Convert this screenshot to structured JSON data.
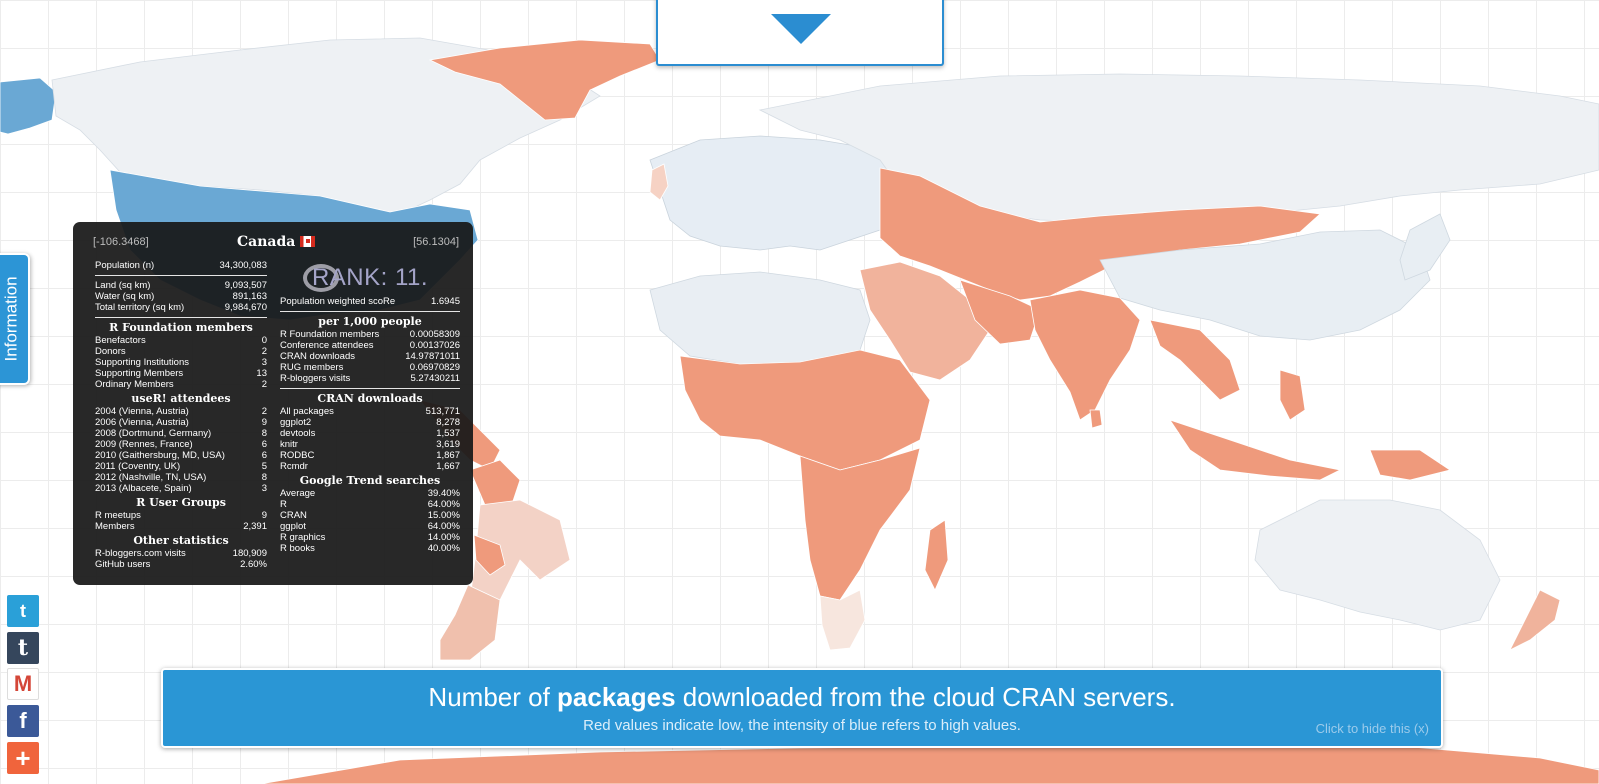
{
  "colors": {
    "accent": "#2a96d5",
    "low": "#ef9a7c",
    "high": "#6aa8d4",
    "neutral": "#eef1f4"
  },
  "info_tab": {
    "label": "Information"
  },
  "tooltip": {
    "coord_left": "[-106.3468]",
    "coord_right": "[56.1304]",
    "country": "Canada",
    "rank": "RANK: 11.",
    "basic": [
      {
        "label": "Population (n)",
        "value": "34,300,083"
      }
    ],
    "area": [
      {
        "label": "Land (sq km)",
        "value": "9,093,507"
      },
      {
        "label": "Water (sq km)",
        "value": "891,163"
      },
      {
        "label": "Total territory (sq km)",
        "value": "9,984,670"
      }
    ],
    "rf_title": "R Foundation members",
    "rf": [
      {
        "label": "Benefactors",
        "value": "0"
      },
      {
        "label": "Donors",
        "value": "2"
      },
      {
        "label": "Supporting Institutions",
        "value": "3"
      },
      {
        "label": "Supporting Members",
        "value": "13"
      },
      {
        "label": "Ordinary Members",
        "value": "2"
      }
    ],
    "user_title": "useR! attendees",
    "user": [
      {
        "label": "2004 (Vienna, Austria)",
        "value": "2"
      },
      {
        "label": "2006 (Vienna, Austria)",
        "value": "9"
      },
      {
        "label": "2008 (Dortmund, Germany)",
        "value": "8"
      },
      {
        "label": "2009 (Rennes, France)",
        "value": "6"
      },
      {
        "label": "2010 (Gaithersburg, MD, USA)",
        "value": "6"
      },
      {
        "label": "2011 (Coventry, UK)",
        "value": "5"
      },
      {
        "label": "2012 (Nashville, TN, USA)",
        "value": "8"
      },
      {
        "label": "2013 (Albacete, Spain)",
        "value": "3"
      }
    ],
    "rug_title": "R User Groups",
    "rug": [
      {
        "label": "R meetups",
        "value": "9"
      },
      {
        "label": "Members",
        "value": "2,391"
      }
    ],
    "other_title": "Other statistics",
    "other": [
      {
        "label": "R-bloggers.com visits",
        "value": "180,909"
      },
      {
        "label": "GitHub users",
        "value": "2.60%"
      }
    ],
    "weighted": {
      "label": "Population weighted scoRe",
      "value": "1.6945"
    },
    "per1000_title": "per 1,000 people",
    "per1000": [
      {
        "label": "R Foundation members",
        "value": "0.00058309"
      },
      {
        "label": "Conference attendees",
        "value": "0.00137026"
      },
      {
        "label": "CRAN downloads",
        "value": "14.97871011"
      },
      {
        "label": "RUG members",
        "value": "0.06970829"
      },
      {
        "label": "R-bloggers visits",
        "value": "5.27430211"
      }
    ],
    "cran_title": "CRAN downloads",
    "cran": [
      {
        "label": "All packages",
        "value": "513,771"
      },
      {
        "label": "ggplot2",
        "value": "8,278"
      },
      {
        "label": "devtools",
        "value": "1,537"
      },
      {
        "label": "knitr",
        "value": "3,619"
      },
      {
        "label": "RODBC",
        "value": "1,867"
      },
      {
        "label": "Rcmdr",
        "value": "1,667"
      }
    ],
    "trends_title": "Google Trend searches",
    "trends": [
      {
        "label": "Average",
        "value": "39.40%"
      },
      {
        "label": "R",
        "value": "64.00%"
      },
      {
        "label": "CRAN",
        "value": "15.00%"
      },
      {
        "label": "ggplot",
        "value": "64.00%"
      },
      {
        "label": "R graphics",
        "value": "14.00%"
      },
      {
        "label": "R books",
        "value": "40.00%"
      }
    ]
  },
  "banner": {
    "title_pre": "Number of ",
    "title_bold": "packages",
    "title_post": " downloaded from the cloud CRAN servers.",
    "subtitle": "Red values indicate low, the intensity of blue refers to high values.",
    "hide": "Click to hide this (x)"
  },
  "social": [
    {
      "name": "twitter",
      "glyph": "t"
    },
    {
      "name": "tumblr",
      "glyph": "t"
    },
    {
      "name": "gmail",
      "glyph": "M"
    },
    {
      "name": "facebook",
      "glyph": "f"
    },
    {
      "name": "addthis",
      "glyph": "+"
    }
  ]
}
